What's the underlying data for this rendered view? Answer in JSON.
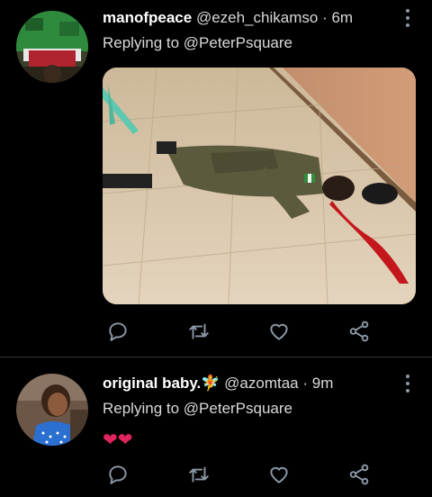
{
  "tweets": [
    {
      "display_name": "manofpeace",
      "handle": "@ezeh_chikamso",
      "separator": "·",
      "time": "6m",
      "replying_prefix": "Replying to",
      "replying_to": "@PeterPsquare",
      "icons": [
        "reply-icon",
        "retweet-icon",
        "like-icon",
        "share-icon",
        "more-icon"
      ]
    },
    {
      "display_name": "original baby.",
      "name_emoji": "🧚",
      "handle": "@azomtaa",
      "separator": "·",
      "time": "9m",
      "replying_prefix": "Replying to",
      "replying_to": "@PeterPsquare",
      "body": "❤❤",
      "icons": [
        "reply-icon",
        "retweet-icon",
        "like-icon",
        "share-icon",
        "more-icon"
      ]
    }
  ],
  "colors": {
    "background": "#000000",
    "icon": "#8b98a5",
    "divider": "#2f3336",
    "heart": "#e0245e"
  }
}
